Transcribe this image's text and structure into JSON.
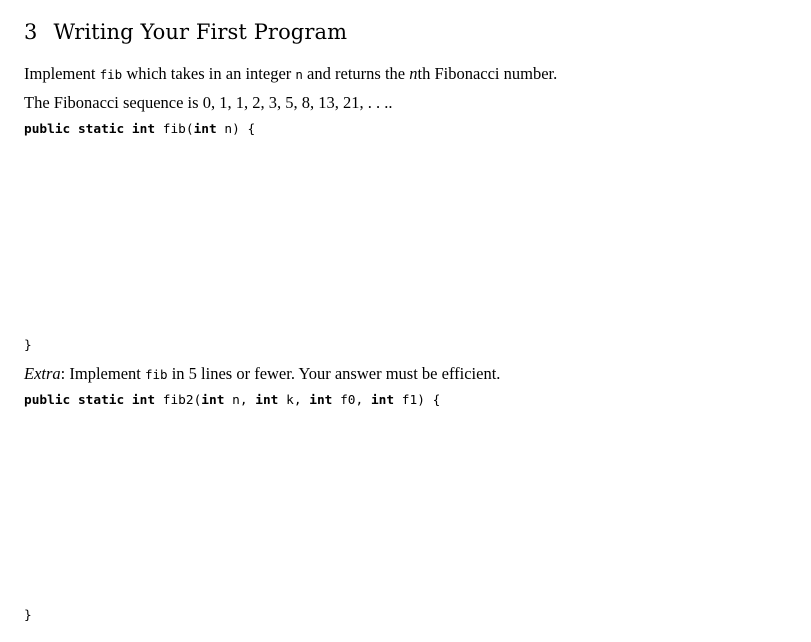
{
  "section": {
    "number": "3",
    "title": "Writing Your First Program"
  },
  "intro": {
    "implement_word": "Implement",
    "fib_code": "fib",
    "which_text": "which takes in an integer",
    "n_code": "n",
    "and_returns_text": "and returns the",
    "nth_var": "n",
    "nth_suffix": "th Fibonacci number."
  },
  "sequence_line": "The Fibonacci sequence is 0, 1, 1, 2, 3, 5, 8, 13, 21, . . ..",
  "code1": {
    "public": "public",
    "static": "static",
    "int": "int",
    "signature_name": "fib(",
    "param_type": "int",
    "param_rest": "n) {",
    "closing_brace": "}"
  },
  "extra": {
    "label": "Extra",
    "colon": ":",
    "implement_word": "Implement",
    "fib_code": "fib",
    "rest_text": "in 5 lines or fewer. Your answer must be efficient."
  },
  "code2": {
    "public": "public",
    "static": "static",
    "int": "int",
    "signature_name": "fib2(",
    "p1_type": "int",
    "p1_name": "n,",
    "p2_type": "int",
    "p2_name": "k,",
    "p3_type": "int",
    "p3_name": "f0,",
    "p4_type": "int",
    "p4_name": "f1) {",
    "closing_brace": "}"
  }
}
